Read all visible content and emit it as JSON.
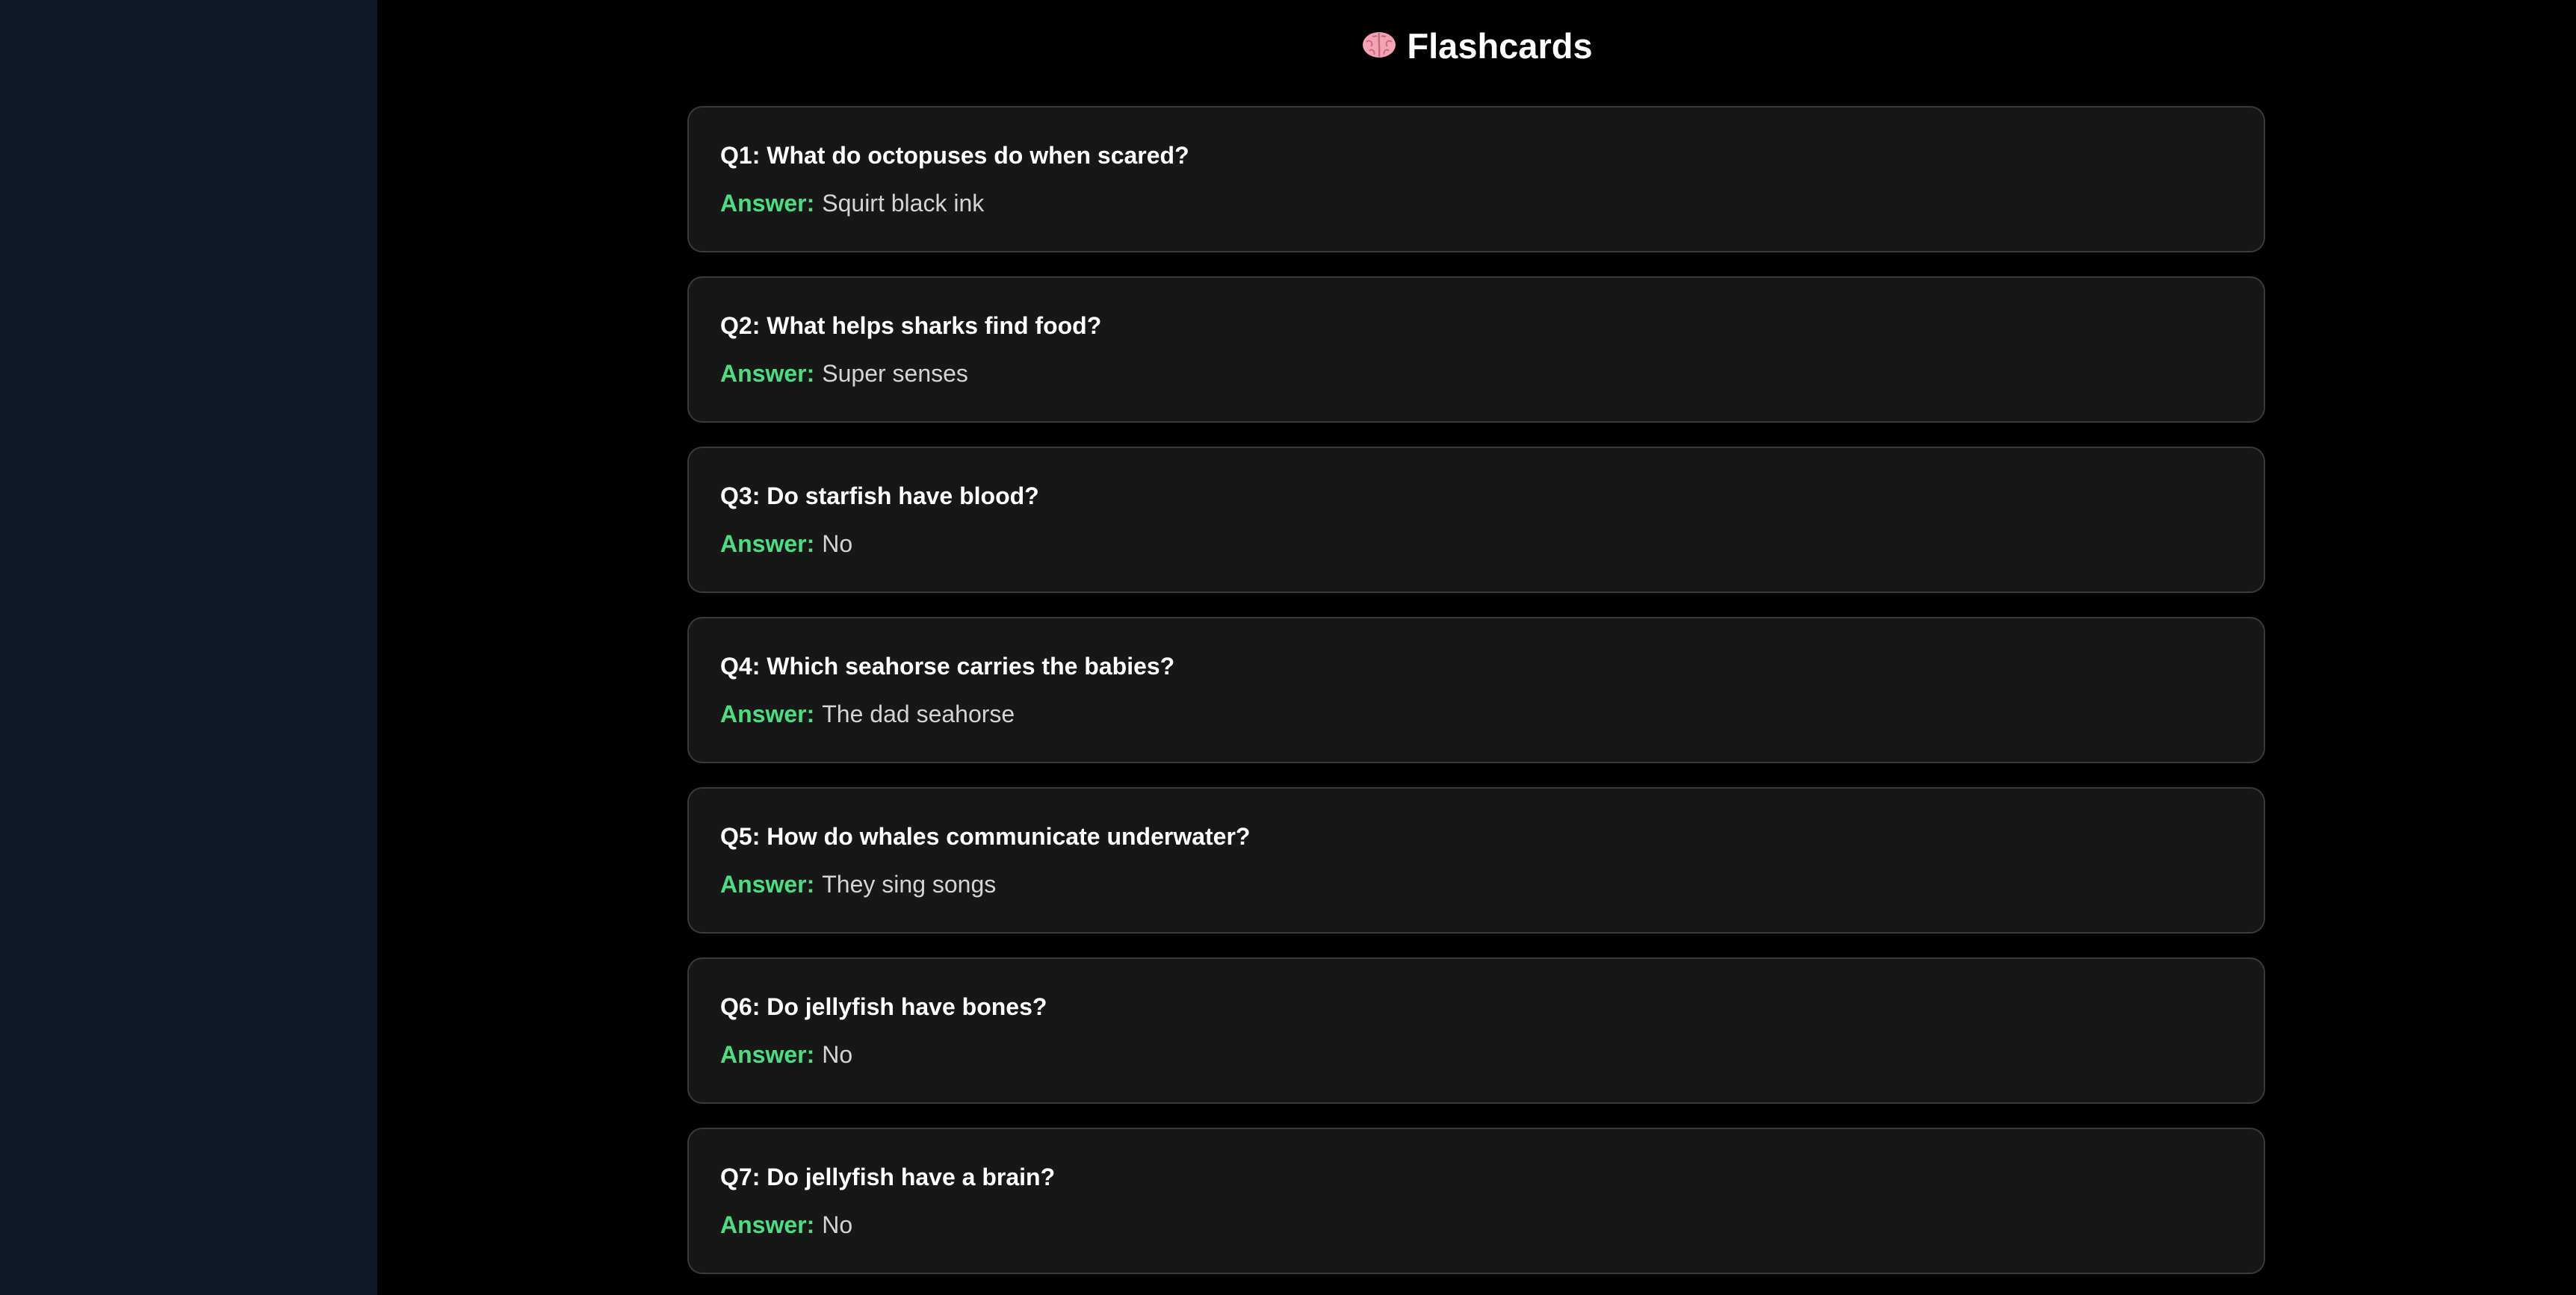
{
  "colors": {
    "sidebar_bg": "#111827",
    "page_bg": "#000000",
    "card_bg": "#171717",
    "card_border": "#3a3a3a",
    "accent_green": "#4ade80"
  },
  "header": {
    "icon": "brain-icon",
    "title": "Flashcards"
  },
  "cards": [
    {
      "question": "Q1: What do octopuses do when scared?",
      "answer_label": "Answer:",
      "answer": "Squirt black ink"
    },
    {
      "question": "Q2: What helps sharks find food?",
      "answer_label": "Answer:",
      "answer": "Super senses"
    },
    {
      "question": "Q3: Do starfish have blood?",
      "answer_label": "Answer:",
      "answer": "No"
    },
    {
      "question": "Q4: Which seahorse carries the babies?",
      "answer_label": "Answer:",
      "answer": "The dad seahorse"
    },
    {
      "question": "Q5: How do whales communicate underwater?",
      "answer_label": "Answer:",
      "answer": "They sing songs"
    },
    {
      "question": "Q6: Do jellyfish have bones?",
      "answer_label": "Answer:",
      "answer": "No"
    },
    {
      "question": "Q7: Do jellyfish have a brain?",
      "answer_label": "Answer:",
      "answer": "No"
    }
  ]
}
